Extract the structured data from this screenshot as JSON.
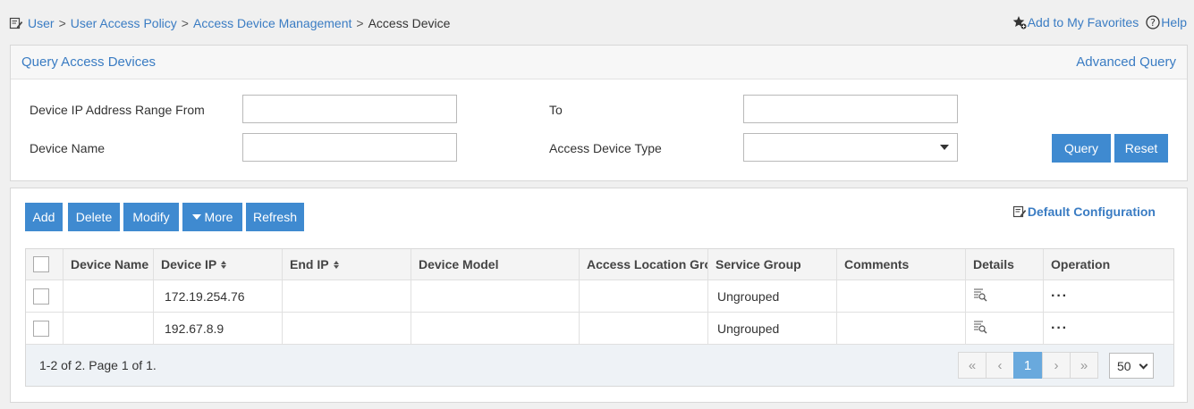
{
  "breadcrumb": {
    "icon": "edit-icon",
    "items": [
      "User",
      "User Access Policy",
      "Access Device Management"
    ],
    "separator": ">",
    "current": "Access Device"
  },
  "toplinks": {
    "favorites": "Add to My Favorites",
    "favorites_icon": "star-add-icon",
    "help": "Help",
    "help_icon": "help-circle-icon"
  },
  "query": {
    "title": "Query Access Devices",
    "advanced": "Advanced Query",
    "ip_from_label": "Device IP Address Range From",
    "ip_from_value": "",
    "ip_to_label": "To",
    "ip_to_value": "",
    "name_label": "Device Name",
    "name_value": "",
    "type_label": "Access Device Type",
    "type_value": "",
    "query_btn": "Query",
    "reset_btn": "Reset"
  },
  "toolbar": {
    "add": "Add",
    "delete": "Delete",
    "modify": "Modify",
    "more": "More",
    "refresh": "Refresh",
    "default_config": "Default Configuration"
  },
  "table": {
    "columns": [
      "Device Name",
      "Device IP",
      "End IP",
      "Device Model",
      "Access Location Group",
      "Service Group",
      "Comments",
      "Details",
      "Operation"
    ],
    "rows": [
      {
        "name": "",
        "ip": "172.19.254.76",
        "end_ip": "",
        "model": "",
        "location": "",
        "service": "Ungrouped",
        "comments": "",
        "operation": "···"
      },
      {
        "name": "",
        "ip": "192.67.8.9",
        "end_ip": "",
        "model": "",
        "location": "",
        "service": "Ungrouped",
        "comments": "",
        "operation": "···"
      }
    ]
  },
  "pager": {
    "summary": "1-2 of 2. Page 1 of 1.",
    "first": "«",
    "prev": "‹",
    "current": "1",
    "next": "›",
    "last": "»",
    "page_size": "50"
  },
  "colors": {
    "accent": "#3f8ad0",
    "link": "#3a7cc3",
    "active_page": "#69a9dd"
  }
}
